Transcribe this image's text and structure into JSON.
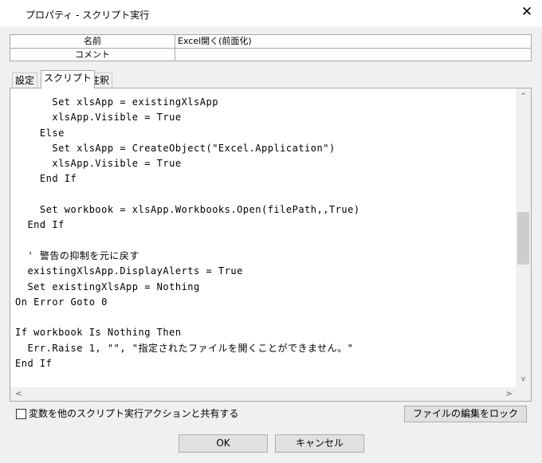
{
  "window": {
    "title": "プロパティ - スクリプト実行",
    "close_glyph": "✕"
  },
  "properties": {
    "rows": [
      {
        "key": "名前",
        "value": "Excel開く(前面化)"
      },
      {
        "key": "コメント",
        "value": ""
      }
    ]
  },
  "tabs": [
    {
      "label": "設定",
      "active": false
    },
    {
      "label": "スクリプト",
      "active": true
    },
    {
      "label": "注釈",
      "active": false
    }
  ],
  "editor": {
    "lines": [
      "      Set xlsApp = existingXlsApp",
      "      xlsApp.Visible = True",
      "    Else",
      "      Set xlsApp = CreateObject(\"Excel.Application\")",
      "      xlsApp.Visible = True",
      "    End If",
      "",
      "    Set workbook = xlsApp.Workbooks.Open(filePath,,True)",
      "  End If",
      "",
      "  ' 警告の抑制を元に戻す",
      "  existingXlsApp.DisplayAlerts = True",
      "  Set existingXlsApp = Nothing",
      "On Error Goto 0",
      "",
      "If workbook Is Nothing Then",
      "  Err.Raise 1, \"\", \"指定されたファイルを開くことができません。\"",
      "End If"
    ],
    "scroll": {
      "up": "^",
      "down": "v",
      "left": "<",
      "right": ">"
    }
  },
  "share_checkbox": {
    "label": "変数を他のスクリプト実行アクションと共有する",
    "checked": false
  },
  "buttons": {
    "lock": "ファイルの編集をロック",
    "ok": "OK",
    "cancel": "キャンセル"
  }
}
